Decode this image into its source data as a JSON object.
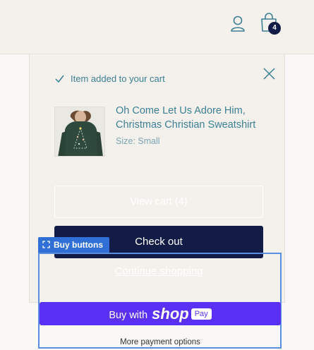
{
  "header": {
    "cart_count": "4"
  },
  "notification": {
    "message": "Item added to your cart",
    "product_title": "Oh Come Let Us Adore Him, Christmas Christian Sweatshirt",
    "product_size": "Size: Small",
    "view_cart_label": "View cart (4)",
    "checkout_label": "Check out",
    "continue_label": "Continue shopping"
  },
  "buy_buttons": {
    "section_label": "Buy buttons",
    "shop_pay_prefix": "Buy with",
    "shop_pay_brand": "shop",
    "shop_pay_badge": "Pay",
    "more_payment_label": "More payment options"
  },
  "colors": {
    "accent": "#3b7f95",
    "checkout": "#121c46",
    "shop_pay": "#5a31f4",
    "editor_outline": "#2f6fd6"
  },
  "icons": [
    "account-icon",
    "cart-icon",
    "check-icon",
    "close-icon",
    "select-icon"
  ]
}
